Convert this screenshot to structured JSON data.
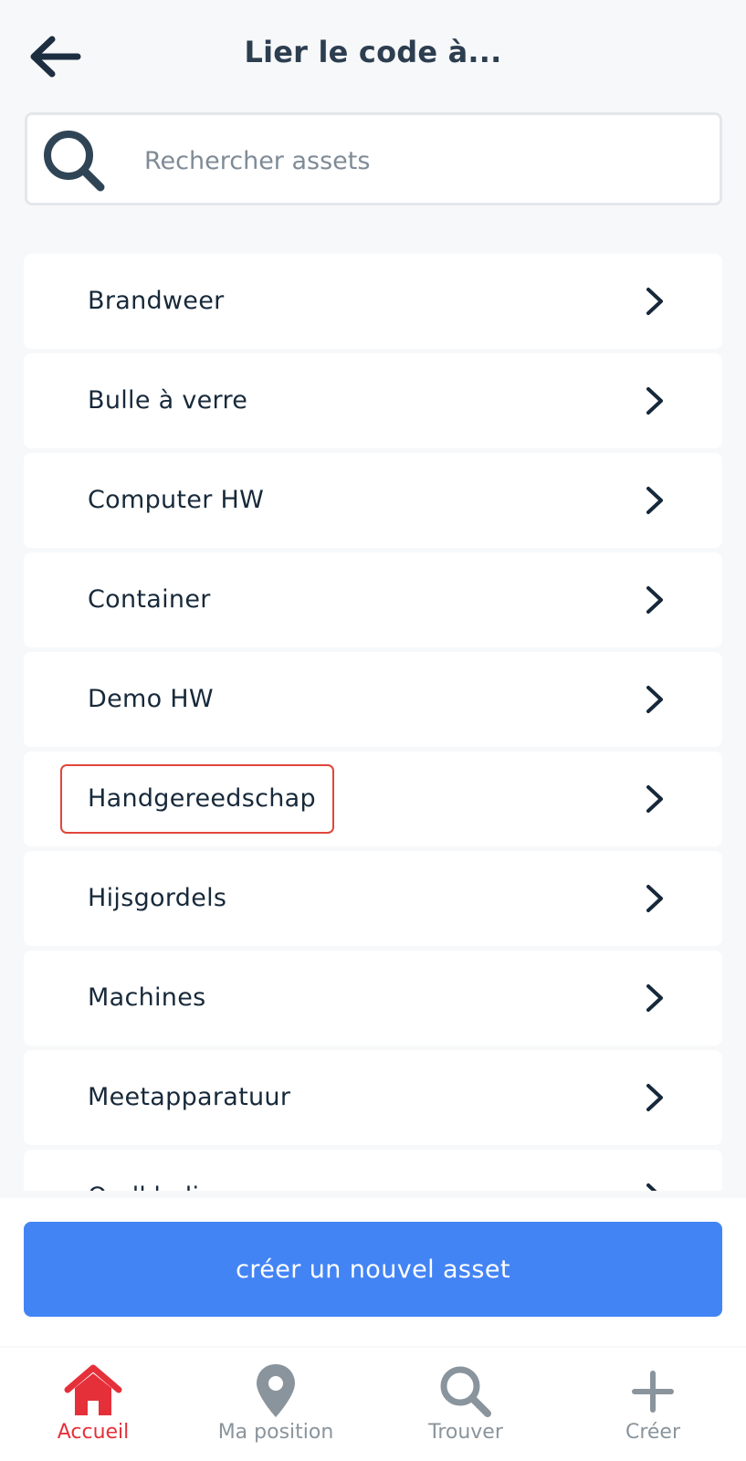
{
  "header": {
    "title": "Lier le code à...",
    "back_icon": "arrow-left-icon"
  },
  "search": {
    "placeholder": "Rechercher assets",
    "value": "",
    "icon": "search-icon"
  },
  "list": {
    "items": [
      {
        "label": "Brandweer"
      },
      {
        "label": "Bulle à verre"
      },
      {
        "label": "Computer HW"
      },
      {
        "label": "Container"
      },
      {
        "label": "Demo HW"
      },
      {
        "label": "Handgereedschap",
        "highlighted": true
      },
      {
        "label": "Hijsgordels"
      },
      {
        "label": "Machines"
      },
      {
        "label": "Meetapparatuur"
      },
      {
        "label": "Oudkleding"
      }
    ],
    "chevron_icon": "chevron-right-icon"
  },
  "actions": {
    "create_asset_label": "créer un nouvel asset"
  },
  "bottom_nav": {
    "items": [
      {
        "label": "Accueil",
        "icon": "home-icon",
        "active": true
      },
      {
        "label": "Ma position",
        "icon": "location-pin-icon",
        "active": false
      },
      {
        "label": "Trouver",
        "icon": "search-icon",
        "active": false
      },
      {
        "label": "Créer",
        "icon": "plus-icon",
        "active": false
      }
    ]
  },
  "colors": {
    "accent_blue": "#4384f4",
    "active_red": "#e5303a",
    "highlight_red": "#e0463b",
    "text_dark": "#17293a",
    "nav_inactive": "#8a949c",
    "background": "#f7f8f9"
  }
}
